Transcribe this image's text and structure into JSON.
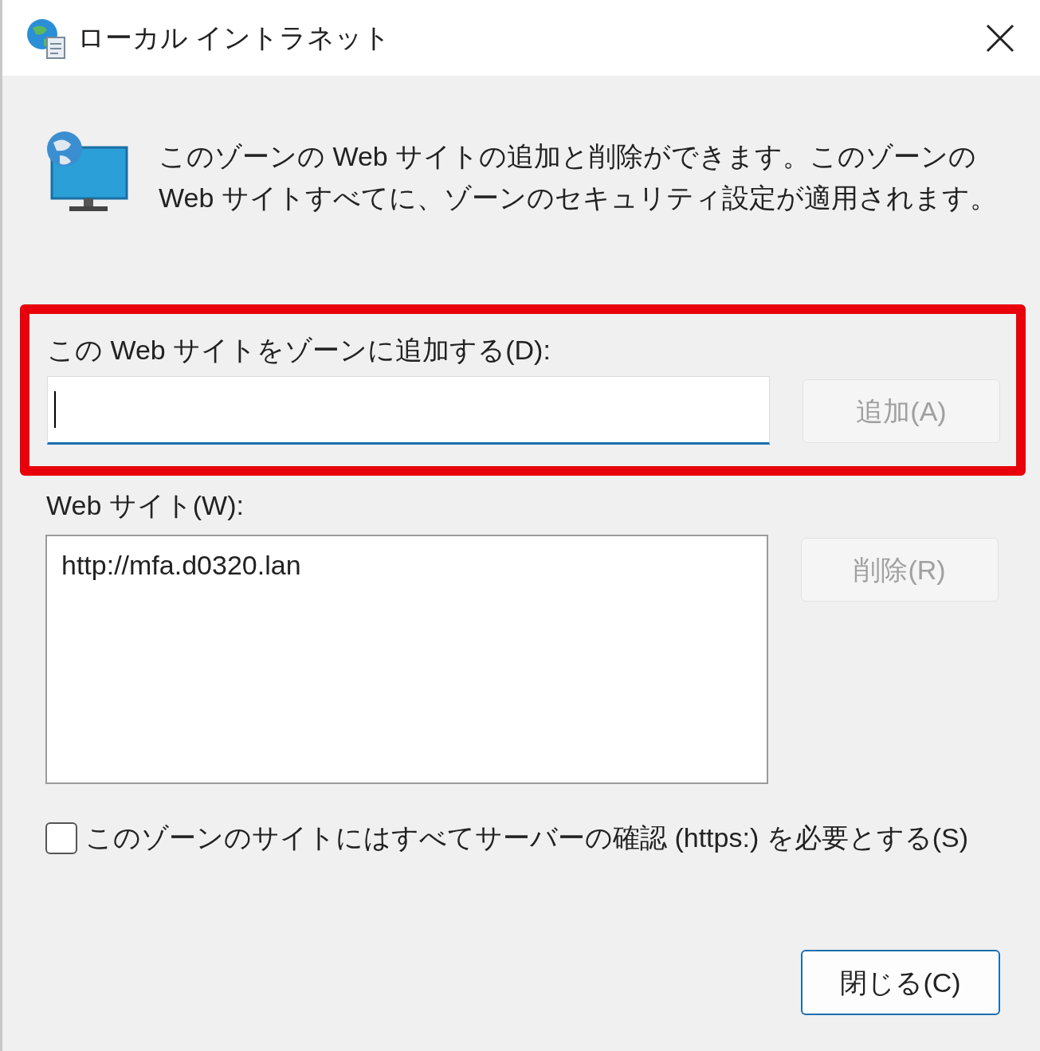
{
  "window": {
    "title": "ローカル イントラネット"
  },
  "description": "このゾーンの Web サイトの追加と削除ができます。このゾーンの Web サイトすべてに、ゾーンのセキュリティ設定が適用されます。",
  "add_site": {
    "label": "この Web サイトをゾーンに追加する(D):",
    "button": {
      "label": "追加(A)",
      "disabled": true
    }
  },
  "websites": {
    "label": "Web サイト(W):",
    "items": [
      {
        "text": "http://mfa.d0320.lan",
        "selected": false
      }
    ],
    "remove_button": {
      "label": "削除(R)",
      "disabled": true
    }
  },
  "require_https": {
    "label": "このゾーンのサイトにはすべてサーバーの確認 (https:) を必要とする(S)",
    "checked": false
  },
  "close_button": {
    "label": "閉じる(C)"
  }
}
